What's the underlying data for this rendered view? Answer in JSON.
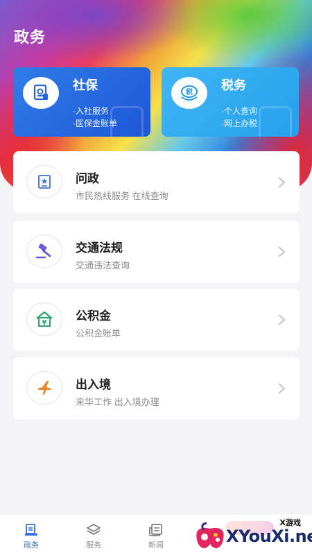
{
  "page": {
    "title": "政务"
  },
  "quick_cards": [
    {
      "title": "社保",
      "lines": [
        "·入社服务",
        "·医保金账单"
      ],
      "icon": "document-icon"
    },
    {
      "title": "税务",
      "lines": [
        "·个人查询",
        "·网上办税"
      ],
      "icon": "tax-icon",
      "icon_text": "税"
    }
  ],
  "services": [
    {
      "title": "问政",
      "subtitle": "市民热线服务 在线查询",
      "icon": "certificate-icon"
    },
    {
      "title": "交通法规",
      "subtitle": "交通违法查询",
      "icon": "gavel-icon"
    },
    {
      "title": "公积金",
      "subtitle": "公积金账单",
      "icon": "house-yuan-icon",
      "icon_text": "¥"
    },
    {
      "title": "出入境",
      "subtitle": "来华工作 出入境办理",
      "icon": "airplane-icon"
    }
  ],
  "tabbar": {
    "items": [
      {
        "label": "政务",
        "active": true,
        "icon": "government-icon"
      },
      {
        "label": "服务",
        "active": false,
        "icon": "layers-icon"
      },
      {
        "label": "新闻",
        "active": false,
        "icon": "news-icon"
      }
    ]
  },
  "watermark": {
    "small": "X游戏",
    "text": "XYouXi.net"
  },
  "colors": {
    "accent": "#2f6ee0",
    "card_social": "#1e56d8",
    "card_tax": "#26a0ee"
  }
}
